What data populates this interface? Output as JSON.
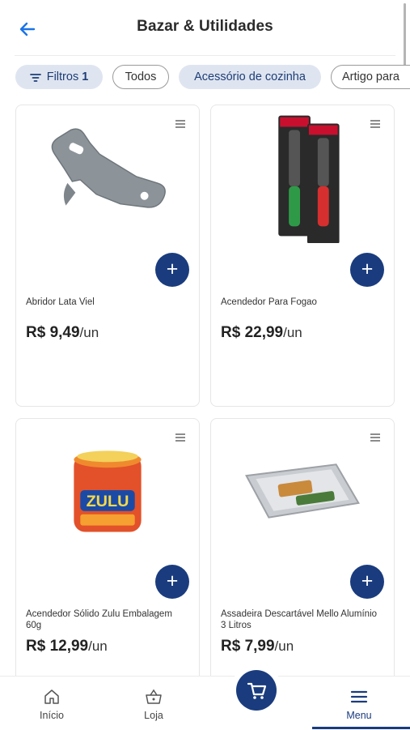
{
  "header": {
    "title": "Bazar & Utilidades"
  },
  "filters": {
    "filter_label": "Filtros",
    "filter_count": "1",
    "chips": [
      "Todos",
      "Acessório de cozinha",
      "Artigo para"
    ]
  },
  "products": [
    {
      "name": "Abridor Lata Viel",
      "price": "R$ 9,49",
      "unit": "/un"
    },
    {
      "name": "Acendedor Para Fogao",
      "price": "R$ 22,99",
      "unit": "/un"
    },
    {
      "name": "Acendedor Sólido Zulu Embalagem 60g",
      "price": "R$ 12,99",
      "unit": "/un",
      "brand_text": "ZULU"
    },
    {
      "name": "Assadeira Descartável Mello Alumínio 3 Litros",
      "price": "R$ 7,99",
      "unit": "/un"
    }
  ],
  "nav": {
    "items": [
      "Início",
      "Loja",
      "Menu"
    ],
    "active": "Menu"
  },
  "colors": {
    "accent": "#1a3c7e",
    "chip_bg": "#dfe5f0"
  },
  "icons": {
    "back": "arrow-left-icon",
    "filter": "filter-icon",
    "card_menu": "list-icon",
    "add": "plus-icon",
    "home": "home-icon",
    "store": "basket-icon",
    "cart": "cart-icon",
    "menu": "hamburger-icon"
  }
}
